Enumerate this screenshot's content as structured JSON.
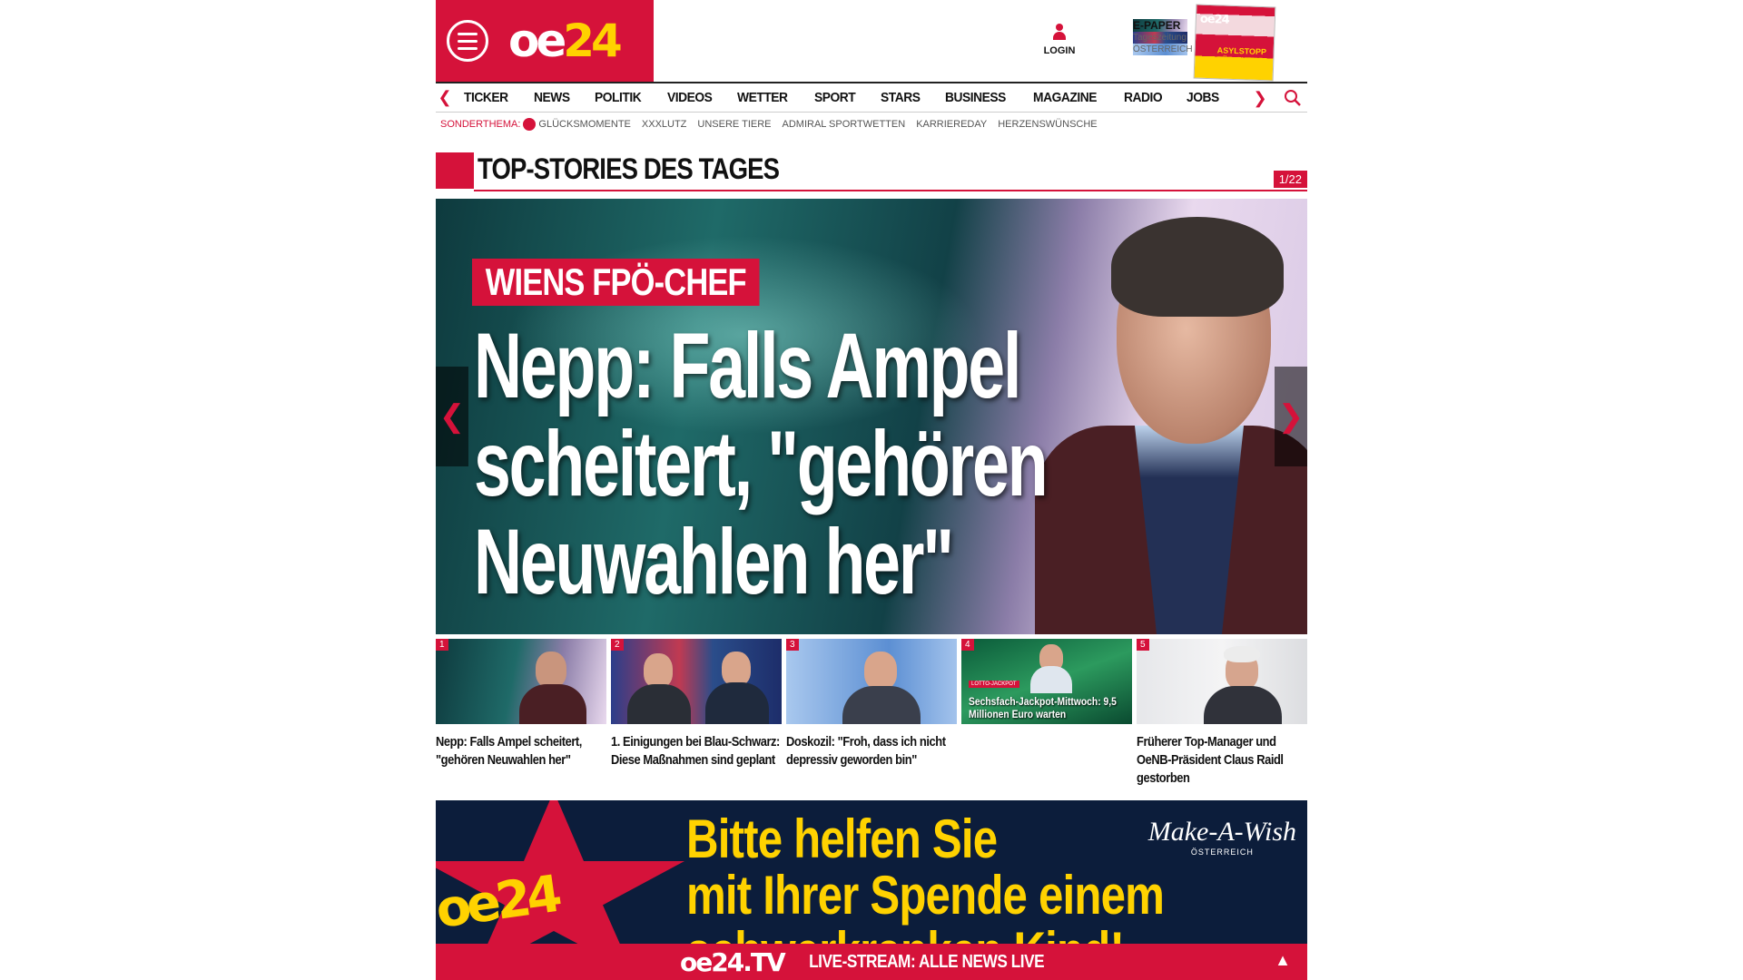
{
  "header": {
    "logo_a": "oe",
    "logo_b": "24",
    "login_label": "LOGIN",
    "epaper": {
      "title": "E-PAPER",
      "line1": "Tageszeitung",
      "line2": "ÖSTERREICH",
      "cover_logo": "oe24",
      "cover_headline": "ASYLSTOPP FÜR SYRER"
    }
  },
  "nav": {
    "items": [
      "TICKER",
      "NEWS",
      "POLITIK",
      "VIDEOS",
      "WETTER",
      "SPORT",
      "STARS",
      "BUSINESS",
      "MAGAZINE",
      "RADIO",
      "JOBS"
    ],
    "prev_icon": "chevron-left-icon",
    "next_icon": "chevron-right-icon",
    "search_icon": "search-icon"
  },
  "subnav": {
    "lead": "SONDERTHEMA:",
    "items": [
      "GLÜCKSMOMENTE",
      "XXXLUTZ",
      "UNSERE TIERE",
      "ADMIRAL SPORTWETTEN",
      "KARRIEREDAY",
      "HERZENSWÜNSCHE"
    ]
  },
  "section": {
    "title": "TOP-STORIES DES TAGES",
    "counter": "1/22"
  },
  "hero": {
    "kicker": "WIENS FPÖ-CHEF",
    "headline_line1": "Nepp: Falls Ampel",
    "headline_line2": "scheitert, \"gehören",
    "headline_line3": "Neuwahlen her\""
  },
  "thumbs": [
    {
      "num": "1",
      "caption": "Nepp: Falls Ampel scheitert, \"gehören Neuwahlen her\"",
      "overlay": "",
      "tag": ""
    },
    {
      "num": "2",
      "caption": "1. Einigungen bei Blau-Schwarz: Diese Maßnahmen sind geplant",
      "overlay": "",
      "tag": ""
    },
    {
      "num": "3",
      "caption": "Doskozil: \"Froh, dass ich nicht depressiv geworden bin\"",
      "overlay": "",
      "tag": ""
    },
    {
      "num": "4",
      "caption": "",
      "overlay": "Sechsfach-Jackpot-Mittwoch: 9,5 Millionen Euro warten",
      "tag": "LOTTO-JACKPOT"
    },
    {
      "num": "5",
      "caption": "Früherer Top-Manager und OeNB-Präsident Claus Raidl gestorben",
      "overlay": "",
      "tag": ""
    }
  ],
  "ad": {
    "logo": "oe24",
    "line1": "Bitte helfen Sie",
    "line2": "mit Ihrer Spende einem",
    "line3": "schwerkranken Kind!",
    "brand": "Make-A-Wish",
    "brand_sub": "ÖSTERREICH"
  },
  "livebar": {
    "logo": "oe24.TV",
    "text": "LIVE-STREAM: ALLE NEWS LIVE",
    "up_icon": "arrow-up-icon"
  },
  "colors": {
    "brand_red": "#d5123a",
    "brand_yellow": "#ffd200",
    "ad_navy": "#0c1d3b"
  }
}
